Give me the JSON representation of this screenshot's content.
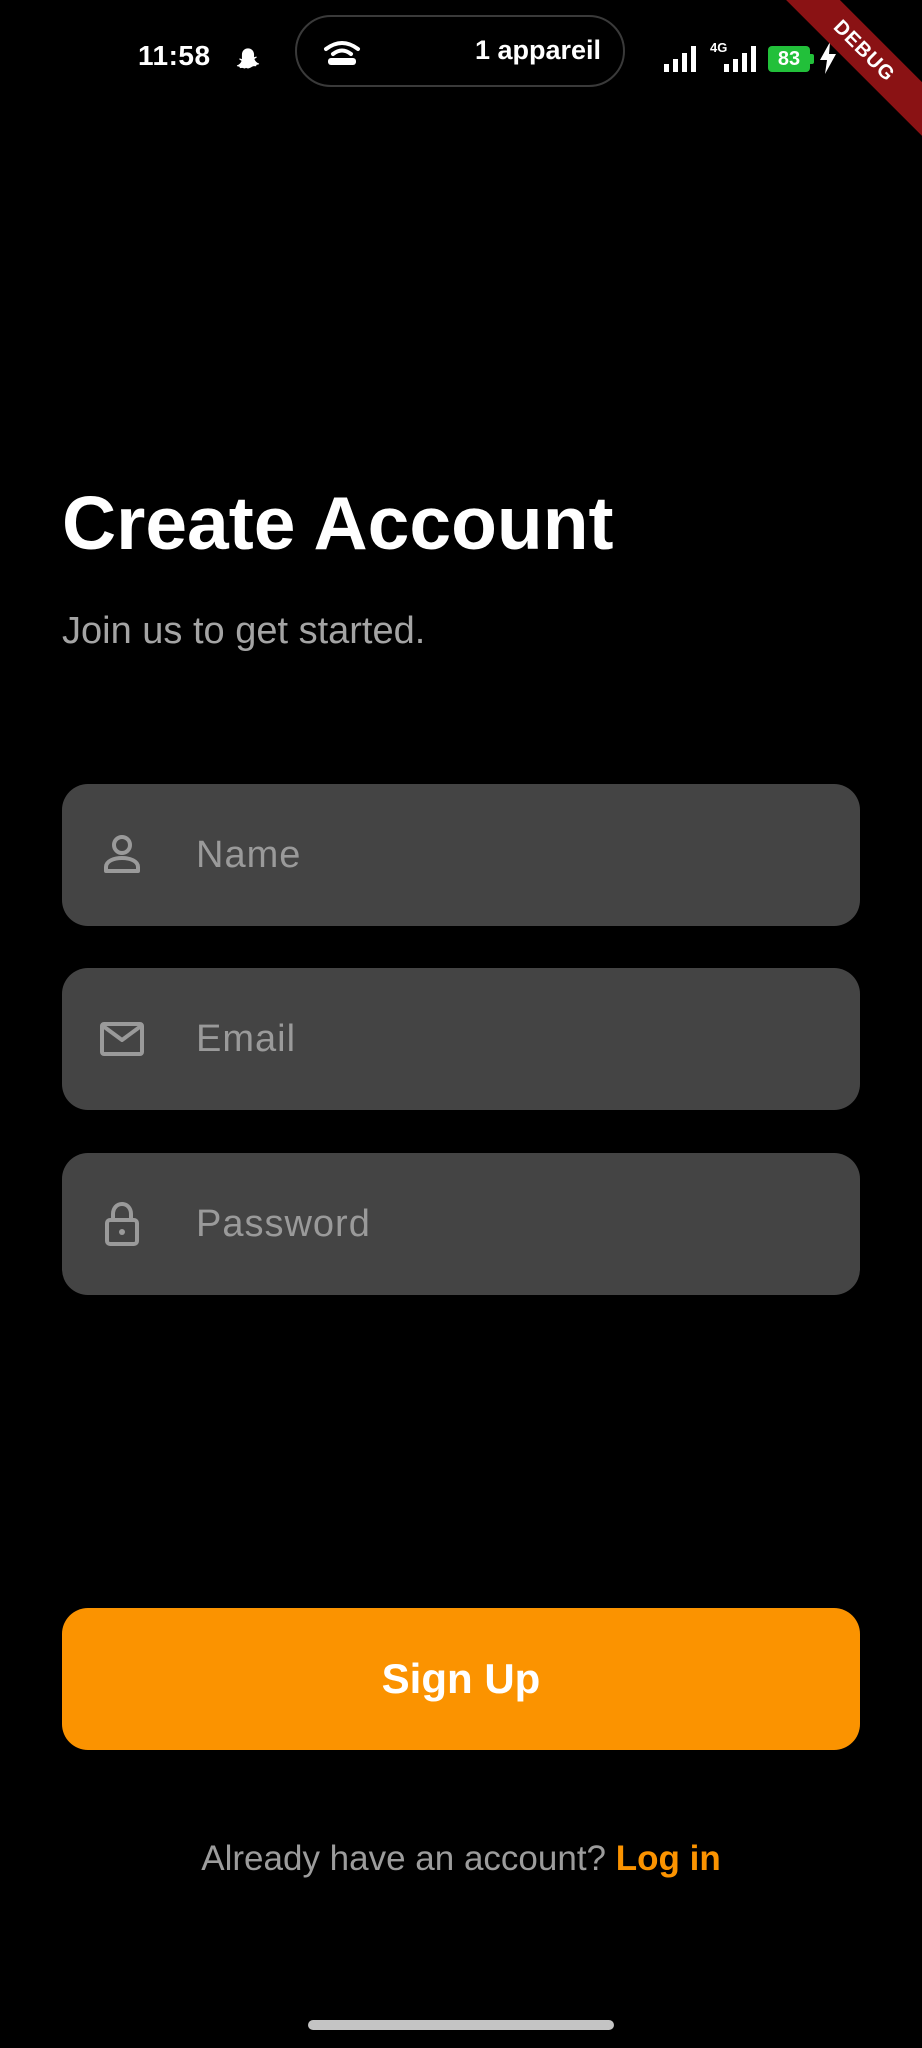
{
  "status_bar": {
    "time": "11:58",
    "notification_icon": "snapchat-ghost-icon",
    "pill_icon": "hotspot-icon",
    "pill_text": "1 appareil",
    "network_type": "4G",
    "battery_level": "83",
    "battery_color": "#22c03a",
    "charging_icon": "bolt-icon"
  },
  "debug_banner": {
    "label": "DEBUG",
    "color": "#8a1214"
  },
  "header": {
    "title": "Create Account",
    "subtitle": "Join us to get started."
  },
  "form": {
    "name": {
      "icon": "person-icon",
      "placeholder": "Name",
      "value": ""
    },
    "email": {
      "icon": "mail-icon",
      "placeholder": "Email",
      "value": ""
    },
    "password": {
      "icon": "lock-icon",
      "placeholder": "Password",
      "value": ""
    }
  },
  "signup_button": {
    "label": "Sign Up"
  },
  "footer": {
    "prompt": "Already have an account?",
    "link_label": "Log in"
  },
  "colors": {
    "background": "#000000",
    "accent": "#fb9300",
    "field_background": "#444444",
    "placeholder": "#9a9a9a",
    "muted_text": "#a4a4a4"
  }
}
